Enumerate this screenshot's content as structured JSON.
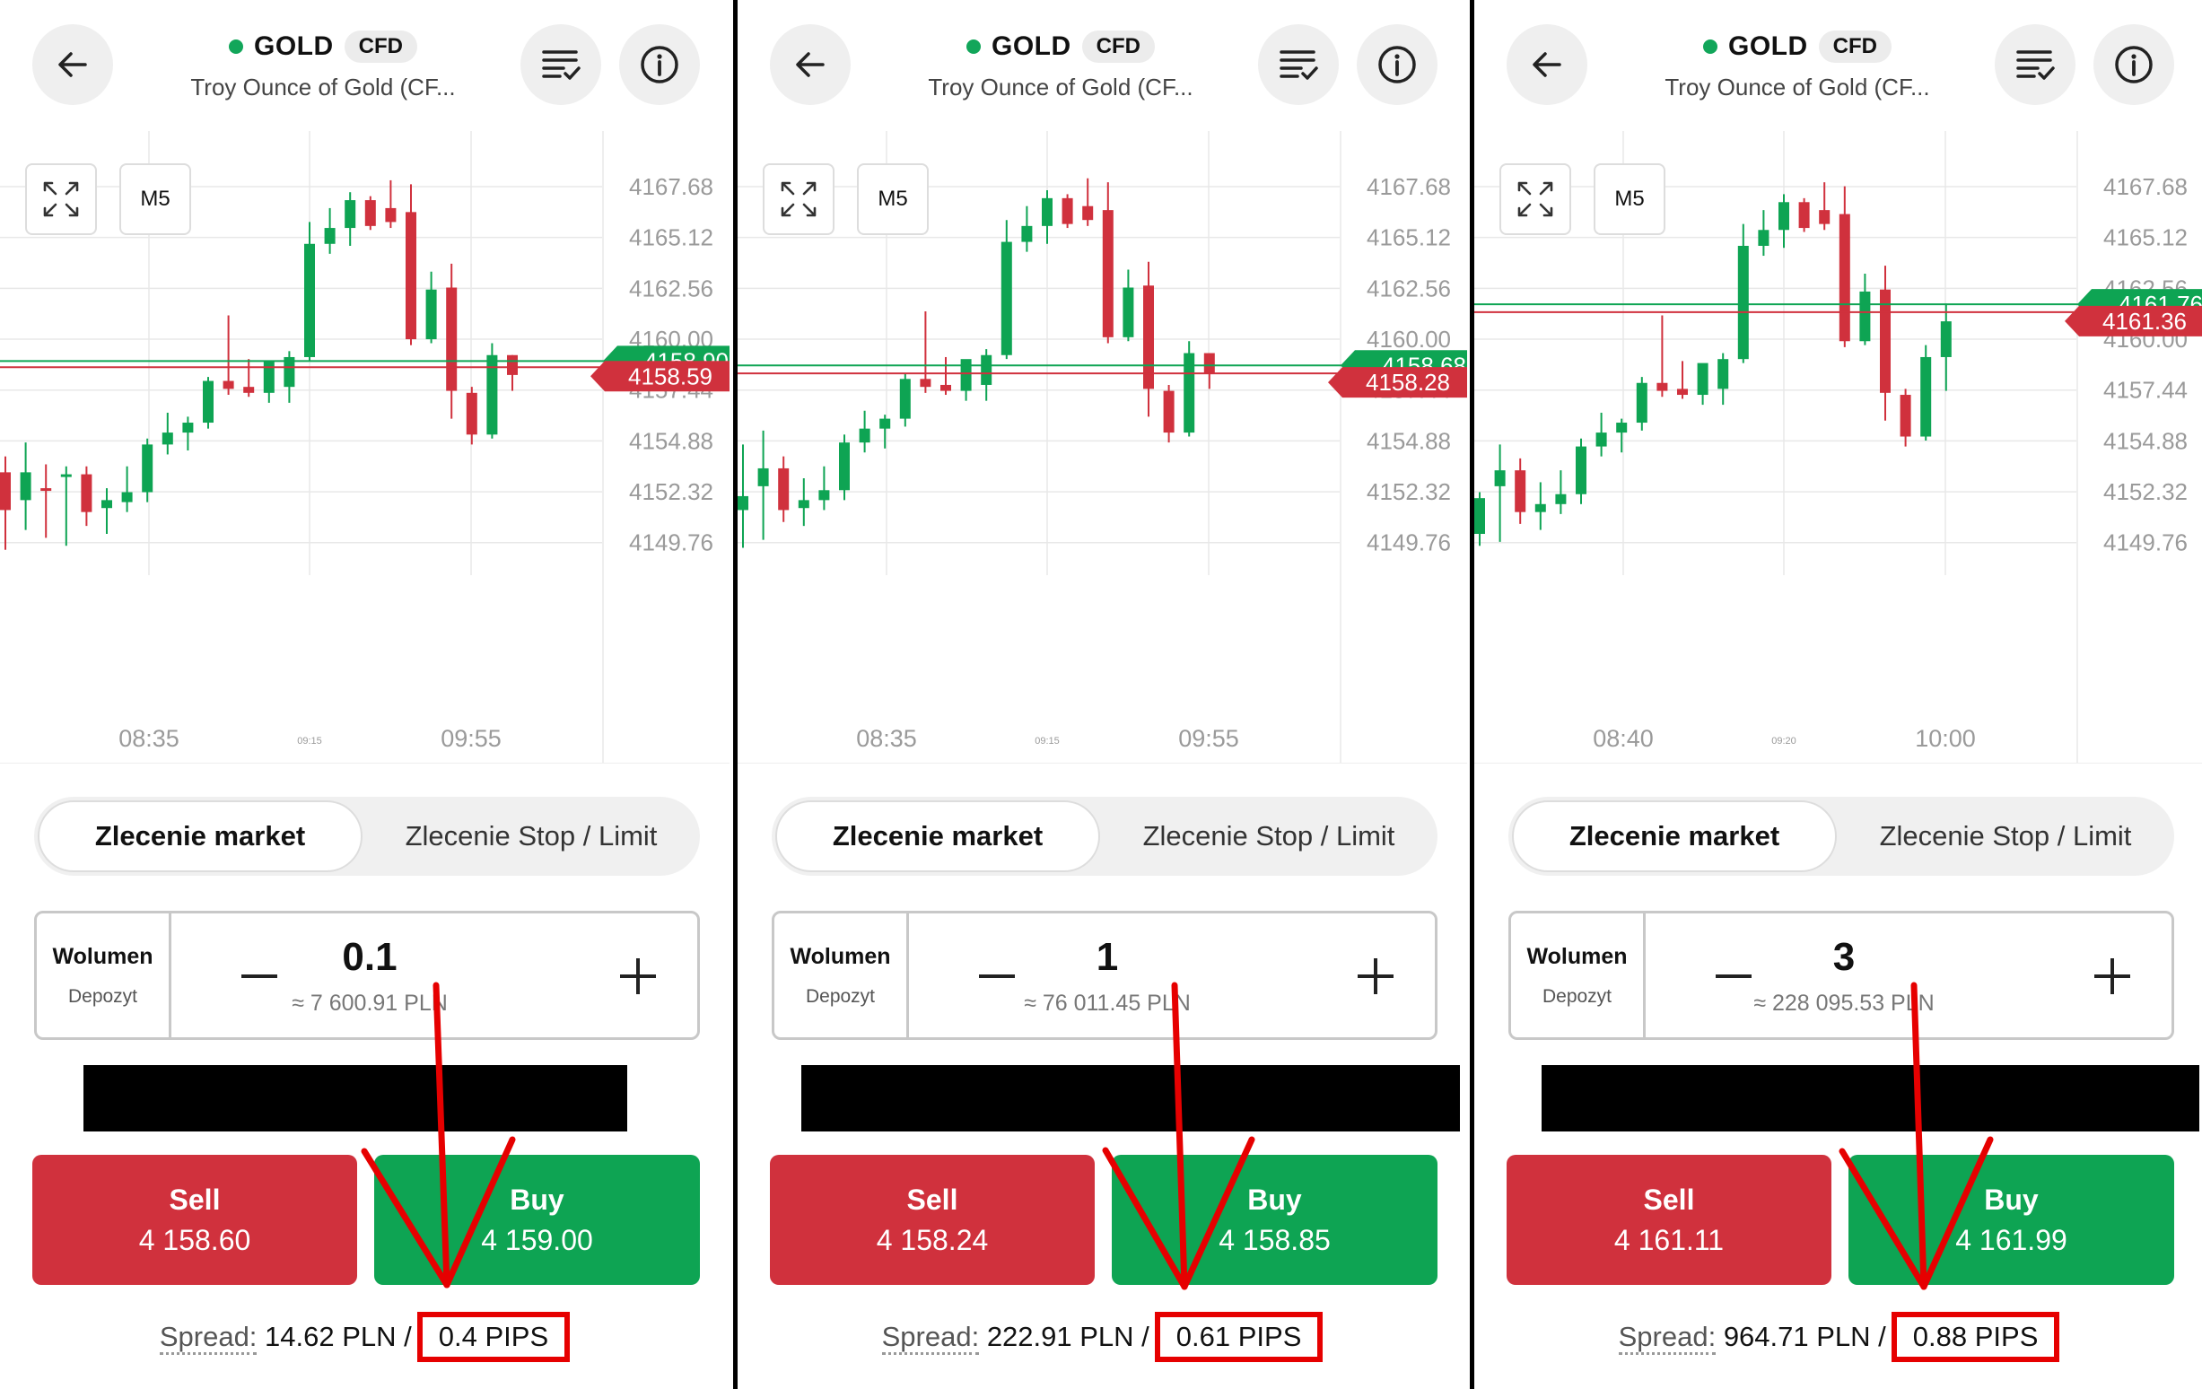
{
  "header": {
    "symbol": "GOLD",
    "badge": "CFD",
    "subtitle": "Troy Ounce of Gold (CF..."
  },
  "icons": {
    "back": "arrow-left-icon",
    "watchlist": "list-check-icon",
    "info": "info-icon",
    "expand": "expand-icon"
  },
  "colors": {
    "buy": "#0ea453",
    "sell": "#d0313d",
    "grid": "#e8e8e8",
    "axis_text": "#9a9a9a",
    "highlight": "#e60000"
  },
  "order_tabs": {
    "market": "Zlecenie market",
    "stop_limit": "Zlecenie Stop / Limit"
  },
  "volume_labels": {
    "title": "Wolumen",
    "sub": "Depozyt"
  },
  "spread_label": "Spread:",
  "panels": [
    {
      "timeframe": "M5",
      "price_axis": [
        "4167.68",
        "4165.12",
        "4162.56",
        "4160.00",
        "4157.44",
        "4154.88",
        "4152.32",
        "4149.76"
      ],
      "time_axis": {
        "left": "08:35",
        "mid": "09:15",
        "right": "09:55"
      },
      "buy_line_label": "4158.90",
      "sell_line_label": "4158.59",
      "volume": "0.1",
      "deposit": "≈ 7 600.91 PLN",
      "sell_label": "Sell",
      "sell_price": "4 158.60",
      "buy_label": "Buy",
      "buy_price": "4 159.00",
      "spread_value": "14.62 PLN",
      "spread_sep": "/",
      "pips": "0.4 PIPS"
    },
    {
      "timeframe": "M5",
      "price_axis": [
        "4167.68",
        "4165.12",
        "4162.56",
        "4160.00",
        "4157.44",
        "4154.88",
        "4152.32",
        "4149.76"
      ],
      "time_axis": {
        "left": "08:35",
        "mid": "09:15",
        "right": "09:55"
      },
      "buy_line_label": "4158.68",
      "sell_line_label": "4158.28",
      "volume": "1",
      "deposit": "≈ 76 011.45 PLN",
      "sell_label": "Sell",
      "sell_price": "4 158.24",
      "buy_label": "Buy",
      "buy_price": "4 158.85",
      "spread_value": "222.91 PLN",
      "spread_sep": "/",
      "pips": "0.61 PIPS"
    },
    {
      "timeframe": "M5",
      "price_axis": [
        "4167.68",
        "4165.12",
        "4162.56",
        "4160.00",
        "4157.44",
        "4154.88",
        "4152.32",
        "4149.76"
      ],
      "time_axis": {
        "left": "08:40",
        "mid": "09:20",
        "right": "10:00"
      },
      "buy_line_label": "4161.76",
      "sell_line_label": "4161.36",
      "volume": "3",
      "deposit": "≈ 228 095.53 PLN",
      "sell_label": "Sell",
      "sell_price": "4 161.11",
      "buy_label": "Buy",
      "buy_price": "4 161.99",
      "spread_value": "964.71 PLN",
      "spread_sep": "/",
      "pips": "0.88 PIPS"
    }
  ],
  "chart_data": [
    {
      "type": "candlestick",
      "ylim": [
        4148.8,
        4168.9
      ],
      "price_lines": {
        "ask": 4158.9,
        "bid": 4158.59
      },
      "candles": [
        {
          "o": 4153.3,
          "h": 4154.1,
          "l": 4149.4,
          "c": 4151.4
        },
        {
          "o": 4151.9,
          "h": 4154.8,
          "l": 4150.4,
          "c": 4153.3
        },
        {
          "o": 4152.5,
          "h": 4153.7,
          "l": 4150.0,
          "c": 4152.4
        },
        {
          "o": 4153.1,
          "h": 4153.6,
          "l": 4149.6,
          "c": 4153.2
        },
        {
          "o": 4153.2,
          "h": 4153.6,
          "l": 4150.6,
          "c": 4151.3
        },
        {
          "o": 4151.5,
          "h": 4152.5,
          "l": 4150.2,
          "c": 4151.9
        },
        {
          "o": 4151.8,
          "h": 4153.6,
          "l": 4151.3,
          "c": 4152.3
        },
        {
          "o": 4152.3,
          "h": 4155.0,
          "l": 4151.8,
          "c": 4154.7
        },
        {
          "o": 4154.7,
          "h": 4156.3,
          "l": 4154.2,
          "c": 4155.3
        },
        {
          "o": 4155.3,
          "h": 4156.1,
          "l": 4154.4,
          "c": 4155.8
        },
        {
          "o": 4155.8,
          "h": 4158.1,
          "l": 4155.5,
          "c": 4157.9
        },
        {
          "o": 4157.9,
          "h": 4161.2,
          "l": 4157.2,
          "c": 4157.5
        },
        {
          "o": 4157.6,
          "h": 4159.0,
          "l": 4157.1,
          "c": 4157.3
        },
        {
          "o": 4157.3,
          "h": 4158.5,
          "l": 4156.8,
          "c": 4158.9
        },
        {
          "o": 4157.6,
          "h": 4159.4,
          "l": 4156.8,
          "c": 4159.1
        },
        {
          "o": 4159.1,
          "h": 4165.9,
          "l": 4158.9,
          "c": 4164.8
        },
        {
          "o": 4164.8,
          "h": 4166.6,
          "l": 4164.3,
          "c": 4165.6
        },
        {
          "o": 4165.6,
          "h": 4167.4,
          "l": 4164.7,
          "c": 4167.0
        },
        {
          "o": 4167.0,
          "h": 4167.2,
          "l": 4165.5,
          "c": 4165.7
        },
        {
          "o": 4166.6,
          "h": 4168.0,
          "l": 4165.6,
          "c": 4165.9
        },
        {
          "o": 4166.4,
          "h": 4167.8,
          "l": 4159.7,
          "c": 4160.0
        },
        {
          "o": 4160.0,
          "h": 4163.4,
          "l": 4159.8,
          "c": 4162.5
        },
        {
          "o": 4162.6,
          "h": 4163.8,
          "l": 4156.0,
          "c": 4157.4
        },
        {
          "o": 4157.3,
          "h": 4157.6,
          "l": 4154.7,
          "c": 4155.2
        },
        {
          "o": 4155.2,
          "h": 4159.8,
          "l": 4155.0,
          "c": 4159.2
        },
        {
          "o": 4159.2,
          "h": 4159.2,
          "l": 4157.4,
          "c": 4158.2
        }
      ]
    },
    {
      "type": "candlestick",
      "ylim": [
        4148.8,
        4168.9
      ],
      "price_lines": {
        "ask": 4158.68,
        "bid": 4158.28
      },
      "candles": [
        {
          "o": 4151.4,
          "h": 4154.7,
          "l": 4149.5,
          "c": 4152.1
        },
        {
          "o": 4152.6,
          "h": 4155.4,
          "l": 4149.9,
          "c": 4153.5
        },
        {
          "o": 4153.5,
          "h": 4154.1,
          "l": 4150.8,
          "c": 4151.4
        },
        {
          "o": 4151.5,
          "h": 4153.0,
          "l": 4150.6,
          "c": 4151.9
        },
        {
          "o": 4151.9,
          "h": 4153.6,
          "l": 4151.4,
          "c": 4152.4
        },
        {
          "o": 4152.4,
          "h": 4155.2,
          "l": 4151.9,
          "c": 4154.8
        },
        {
          "o": 4154.8,
          "h": 4156.4,
          "l": 4154.3,
          "c": 4155.5
        },
        {
          "o": 4155.5,
          "h": 4156.2,
          "l": 4154.5,
          "c": 4156.0
        },
        {
          "o": 4156.0,
          "h": 4158.3,
          "l": 4155.6,
          "c": 4158.0
        },
        {
          "o": 4158.0,
          "h": 4161.4,
          "l": 4157.3,
          "c": 4157.6
        },
        {
          "o": 4157.7,
          "h": 4159.1,
          "l": 4157.2,
          "c": 4157.4
        },
        {
          "o": 4157.4,
          "h": 4158.6,
          "l": 4156.9,
          "c": 4159.0
        },
        {
          "o": 4157.7,
          "h": 4159.5,
          "l": 4156.9,
          "c": 4159.2
        },
        {
          "o": 4159.2,
          "h": 4166.0,
          "l": 4159.0,
          "c": 4164.9
        },
        {
          "o": 4164.9,
          "h": 4166.7,
          "l": 4164.4,
          "c": 4165.7
        },
        {
          "o": 4165.7,
          "h": 4167.5,
          "l": 4164.8,
          "c": 4167.1
        },
        {
          "o": 4167.1,
          "h": 4167.3,
          "l": 4165.6,
          "c": 4165.8
        },
        {
          "o": 4166.7,
          "h": 4168.1,
          "l": 4165.7,
          "c": 4166.0
        },
        {
          "o": 4166.5,
          "h": 4167.9,
          "l": 4159.8,
          "c": 4160.1
        },
        {
          "o": 4160.1,
          "h": 4163.5,
          "l": 4159.9,
          "c": 4162.6
        },
        {
          "o": 4162.7,
          "h": 4163.9,
          "l": 4156.1,
          "c": 4157.5
        },
        {
          "o": 4157.4,
          "h": 4157.7,
          "l": 4154.8,
          "c": 4155.3
        },
        {
          "o": 4155.3,
          "h": 4159.9,
          "l": 4155.1,
          "c": 4159.3
        },
        {
          "o": 4159.3,
          "h": 4159.3,
          "l": 4157.5,
          "c": 4158.3
        }
      ]
    },
    {
      "type": "candlestick",
      "ylim": [
        4148.8,
        4168.9
      ],
      "price_lines": {
        "ask": 4161.76,
        "bid": 4161.36
      },
      "candles": [
        {
          "o": 4150.2,
          "h": 4152.3,
          "l": 4149.6,
          "c": 4152.0
        },
        {
          "o": 4152.6,
          "h": 4154.7,
          "l": 4149.8,
          "c": 4153.4
        },
        {
          "o": 4153.4,
          "h": 4154.0,
          "l": 4150.7,
          "c": 4151.3
        },
        {
          "o": 4151.3,
          "h": 4152.8,
          "l": 4150.4,
          "c": 4151.7
        },
        {
          "o": 4151.7,
          "h": 4153.4,
          "l": 4151.2,
          "c": 4152.2
        },
        {
          "o": 4152.2,
          "h": 4155.0,
          "l": 4151.7,
          "c": 4154.6
        },
        {
          "o": 4154.6,
          "h": 4156.3,
          "l": 4154.1,
          "c": 4155.3
        },
        {
          "o": 4155.3,
          "h": 4156.0,
          "l": 4154.3,
          "c": 4155.8
        },
        {
          "o": 4155.8,
          "h": 4158.1,
          "l": 4155.4,
          "c": 4157.8
        },
        {
          "o": 4157.8,
          "h": 4161.2,
          "l": 4157.1,
          "c": 4157.4
        },
        {
          "o": 4157.5,
          "h": 4158.9,
          "l": 4157.0,
          "c": 4157.2
        },
        {
          "o": 4157.2,
          "h": 4158.4,
          "l": 4156.7,
          "c": 4158.8
        },
        {
          "o": 4157.5,
          "h": 4159.3,
          "l": 4156.7,
          "c": 4159.0
        },
        {
          "o": 4159.0,
          "h": 4165.8,
          "l": 4158.8,
          "c": 4164.7
        },
        {
          "o": 4164.7,
          "h": 4166.5,
          "l": 4164.2,
          "c": 4165.5
        },
        {
          "o": 4165.5,
          "h": 4167.3,
          "l": 4164.6,
          "c": 4166.9
        },
        {
          "o": 4166.9,
          "h": 4167.1,
          "l": 4165.4,
          "c": 4165.6
        },
        {
          "o": 4166.5,
          "h": 4167.9,
          "l": 4165.5,
          "c": 4165.8
        },
        {
          "o": 4166.3,
          "h": 4167.7,
          "l": 4159.6,
          "c": 4159.9
        },
        {
          "o": 4159.9,
          "h": 4163.3,
          "l": 4159.7,
          "c": 4162.4
        },
        {
          "o": 4162.5,
          "h": 4163.7,
          "l": 4155.9,
          "c": 4157.3
        },
        {
          "o": 4157.2,
          "h": 4157.5,
          "l": 4154.6,
          "c": 4155.1
        },
        {
          "o": 4155.1,
          "h": 4159.7,
          "l": 4154.9,
          "c": 4159.1
        },
        {
          "o": 4159.1,
          "h": 4161.8,
          "l": 4157.4,
          "c": 4160.9
        }
      ]
    }
  ]
}
